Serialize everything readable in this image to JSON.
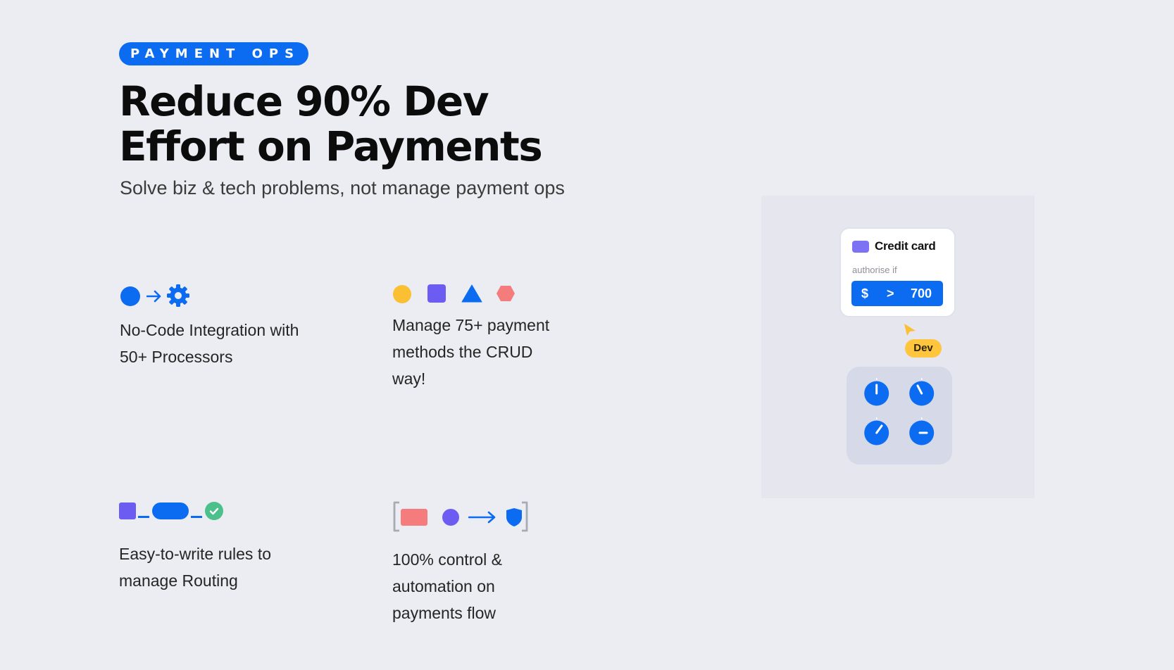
{
  "badge": {
    "label": "PAYMENT OPS"
  },
  "hero": {
    "title_line1": "Reduce 90% Dev",
    "title_line2": "Effort on Payments",
    "subtitle": "Solve biz & tech problems, not manage payment ops"
  },
  "features": [
    {
      "line1": "No-Code Integration with",
      "line2": "50+ Processors",
      "icons": [
        "circle-icon",
        "arrow-right-icon",
        "gear-icon"
      ]
    },
    {
      "line1": "Manage 75+ payment",
      "line2": "methods the CRUD",
      "line3": "way!",
      "icons": [
        "circle-icon",
        "square-icon",
        "triangle-icon",
        "hexagon-icon"
      ]
    },
    {
      "line1": "Easy-to-write rules to",
      "line2": "manage Routing",
      "icons": [
        "square-icon",
        "pill-icon",
        "check-circle-icon"
      ]
    },
    {
      "line1": "100% control &",
      "line2": "automation on",
      "line3": "payments flow",
      "icons": [
        "bracket-icon",
        "card-icon",
        "circle-icon",
        "arrow-right-icon",
        "shield-icon"
      ]
    }
  ],
  "illustration": {
    "card_title": "Credit card",
    "card_subtitle": "authorise if",
    "rule": {
      "currency": "$",
      "operator": ">",
      "value": "700"
    },
    "user_tag": "Dev",
    "knob_count": 4
  },
  "colors": {
    "background": "#ecedf2",
    "primary": "#0b6cf2",
    "purple": "#6c5cf2",
    "yellow": "#fbbf33",
    "coral": "#f47c7c",
    "green": "#4cc08a"
  }
}
